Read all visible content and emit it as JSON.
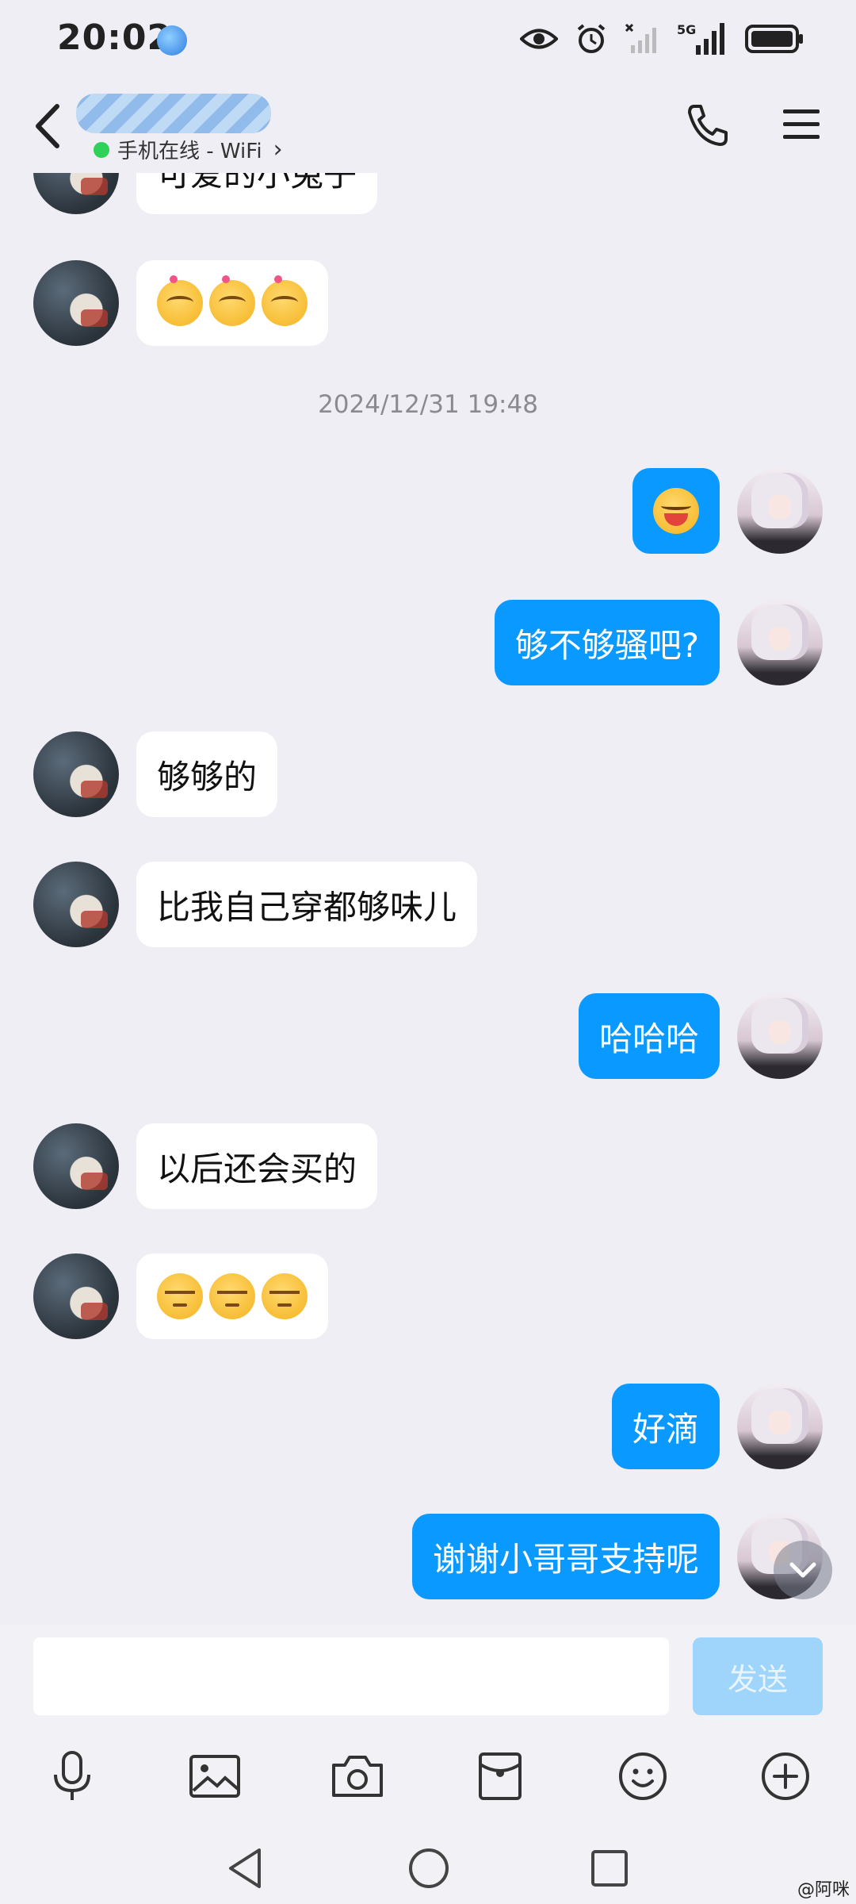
{
  "status_bar": {
    "time": "20:02",
    "network": "5G"
  },
  "header": {
    "presence": "手机在线 - WiFi",
    "presence_chevron": "›"
  },
  "messages": [
    {
      "side": "in",
      "text": "可爱的小兔子",
      "emoji_count": 0
    },
    {
      "side": "in",
      "text": "",
      "emoji": "blush-heart-emoji",
      "emoji_count": 3
    },
    {
      "side": "out",
      "text": "",
      "emoji": "laugh-emoji",
      "emoji_count": 1
    },
    {
      "side": "out",
      "text": "够不够骚吧?"
    },
    {
      "side": "in",
      "text": "够够的"
    },
    {
      "side": "in",
      "text": "比我自己穿都够味儿"
    },
    {
      "side": "out",
      "text": "哈哈哈"
    },
    {
      "side": "in",
      "text": "以后还会买的"
    },
    {
      "side": "in",
      "text": "",
      "emoji": "salute-emoji",
      "emoji_count": 3
    },
    {
      "side": "out",
      "text": "好滴"
    },
    {
      "side": "out",
      "text": "谢谢小哥哥支持呢"
    }
  ],
  "timestamp": "2024/12/31 19:48",
  "composer": {
    "send_label": "发送",
    "input_placeholder": ""
  },
  "toolbar_icons": [
    "microphone-icon",
    "image-icon",
    "camera-icon",
    "red-packet-icon",
    "emoji-icon",
    "plus-icon"
  ],
  "watermark": "@阿咪",
  "colors": {
    "outgoing_bubble": "#0a99ff",
    "incoming_bubble": "#ffffff",
    "background": "#eeeef4",
    "send_button": "#9fd4fb"
  }
}
